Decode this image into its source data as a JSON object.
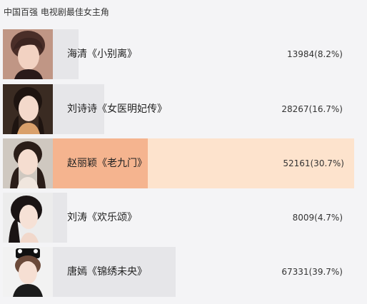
{
  "poll": {
    "title": "中国百强 电视剧最佳女主角",
    "highlight_color": "#fde3cd",
    "bar_color": "#e6e6e9",
    "highlight_bar_color": "#f5b48f",
    "candidates": [
      {
        "name": "海清《小别离》",
        "votes_text": "13984(8.2%)",
        "votes": 13984,
        "percent": 8.2,
        "avatar": "avatar-photo",
        "highlighted": false
      },
      {
        "name": "刘诗诗《女医明妃传》",
        "votes_text": "28267(16.7%)",
        "votes": 28267,
        "percent": 16.7,
        "avatar": "avatar-photo",
        "highlighted": false
      },
      {
        "name": "赵丽颖《老九门》",
        "votes_text": "52161(30.7%)",
        "votes": 52161,
        "percent": 30.7,
        "avatar": "avatar-photo",
        "highlighted": true
      },
      {
        "name": "刘涛《欢乐颂》",
        "votes_text": "8009(4.7%)",
        "votes": 8009,
        "percent": 4.7,
        "avatar": "avatar-photo",
        "highlighted": false
      },
      {
        "name": "唐嫣《锦绣未央》",
        "votes_text": "67331(39.7%)",
        "votes": 67331,
        "percent": 39.7,
        "avatar": "avatar-photo",
        "highlighted": false
      }
    ]
  }
}
